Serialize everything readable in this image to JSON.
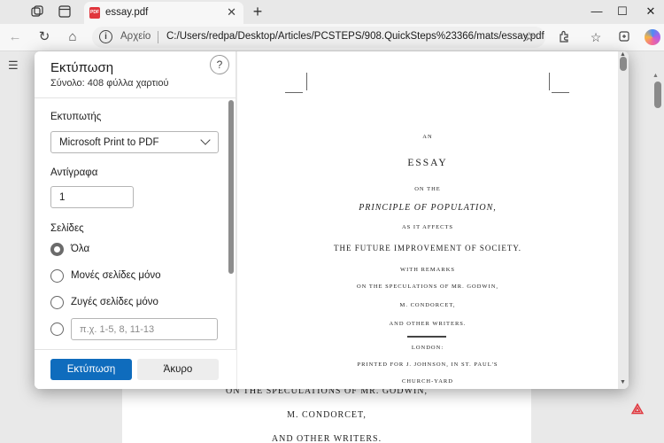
{
  "browser": {
    "tab_title": "essay.pdf",
    "tab_icon": "PDF",
    "source_label": "Αρχείο",
    "url": "C:/Users/redpa/Desktop/Articles/PCSTEPS/908.QuickSteps%23366/mats/essay.pdf"
  },
  "background_page": {
    "lines": [
      "ON THE SPECULATIONS OF MR. GODWIN,",
      "M. CONDORCET,",
      "AND OTHER WRITERS."
    ]
  },
  "print_dialog": {
    "title": "Εκτύπωση",
    "subtitle": "Σύνολο: 408 φύλλα χαρτιού",
    "help_label": "?",
    "printer_label": "Εκτυπωτής",
    "printer_value": "Microsoft Print to PDF",
    "copies_label": "Αντίγραφα",
    "copies_value": "1",
    "pages_label": "Σελίδες",
    "page_options": [
      {
        "label": "Όλα",
        "selected": true
      },
      {
        "label": "Μονές σελίδες μόνο",
        "selected": false
      },
      {
        "label": "Ζυγές σελίδες μόνο",
        "selected": false
      }
    ],
    "range_placeholder": "π.χ. 1-5, 8, 11-13",
    "print_button": "Εκτύπωση",
    "cancel_button": "Άκυρο"
  },
  "preview_page": {
    "lines": [
      "AN",
      "ESSAY",
      "ON THE",
      "PRINCIPLE OF POPULATION,",
      "AS IT AFFECTS",
      "THE FUTURE IMPROVEMENT OF SOCIETY.",
      "WITH REMARKS",
      "ON THE SPECULATIONS OF MR. GODWIN,",
      "M. CONDORCET,",
      "AND OTHER WRITERS.",
      "LONDON:",
      "PRINTED FOR J. JOHNSON, IN ST. PAUL'S",
      "CHURCH-YARD"
    ]
  },
  "colors": {
    "accent": "#0f6cbd",
    "pdf_red": "#e0363d"
  }
}
